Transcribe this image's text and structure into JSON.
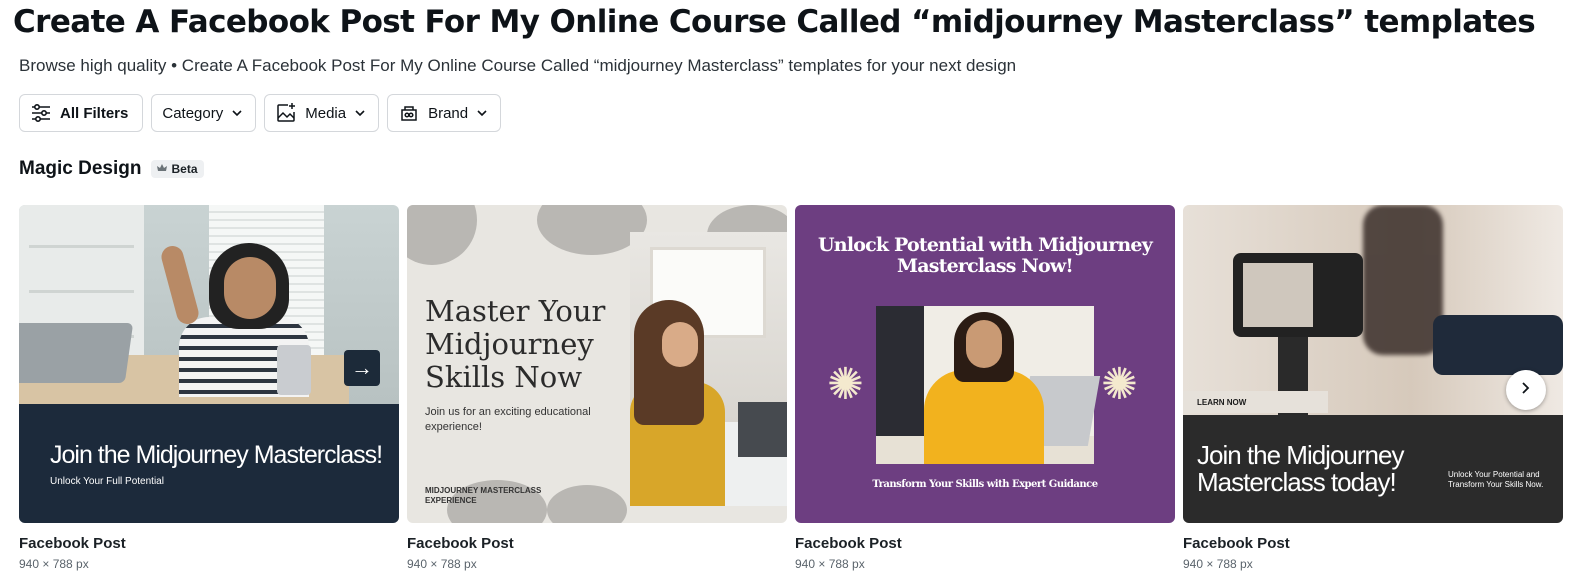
{
  "page": {
    "title": "Create A Facebook Post For My Online Course Called “midjourney Masterclass” templates",
    "subtitle": "Browse high quality • Create A Facebook Post For My Online Course Called “midjourney Masterclass” templates for your next design"
  },
  "filters": [
    {
      "label": "All Filters",
      "icon": "sliders-icon"
    },
    {
      "label": "Category",
      "icon": "chevron-down-icon"
    },
    {
      "label": "Media",
      "icon": "image-sparkle-icon"
    },
    {
      "label": "Brand",
      "icon": "brand-kit-icon"
    }
  ],
  "section": {
    "title": "Magic Design",
    "badge": "Beta",
    "badge_icon": "crown-icon"
  },
  "cards": [
    {
      "type": "Facebook Post",
      "size": "940 × 788 px",
      "headline": "Join the Midjourney Masterclass!",
      "subline": "Unlock Your Full Potential",
      "accent": "#1c2a3b"
    },
    {
      "type": "Facebook Post",
      "size": "940 × 788 px",
      "headline": "Master Your Midjourney Skills Now",
      "body": "Join us for an exciting educational experience!",
      "footer": "MIDJOURNEY MASTERCLASS EXPERIENCE",
      "accent": "#e8e6e1"
    },
    {
      "type": "Facebook Post",
      "size": "940 × 788 px",
      "headline": "Unlock Potential with Midjourney Masterclass Now!",
      "subline": "Transform Your Skills with Expert Guidance",
      "accent": "#6d3e81"
    },
    {
      "type": "Facebook Post",
      "size": "940 × 788 px",
      "tag": "LEARN NOW",
      "headline": "Join the Midjourney Masterclass today!",
      "subline": "Unlock Your Potential and Transform Your Skills Now.",
      "accent": "#2b2b2b"
    }
  ],
  "carousel": {
    "next_icon": "chevron-right-icon"
  }
}
